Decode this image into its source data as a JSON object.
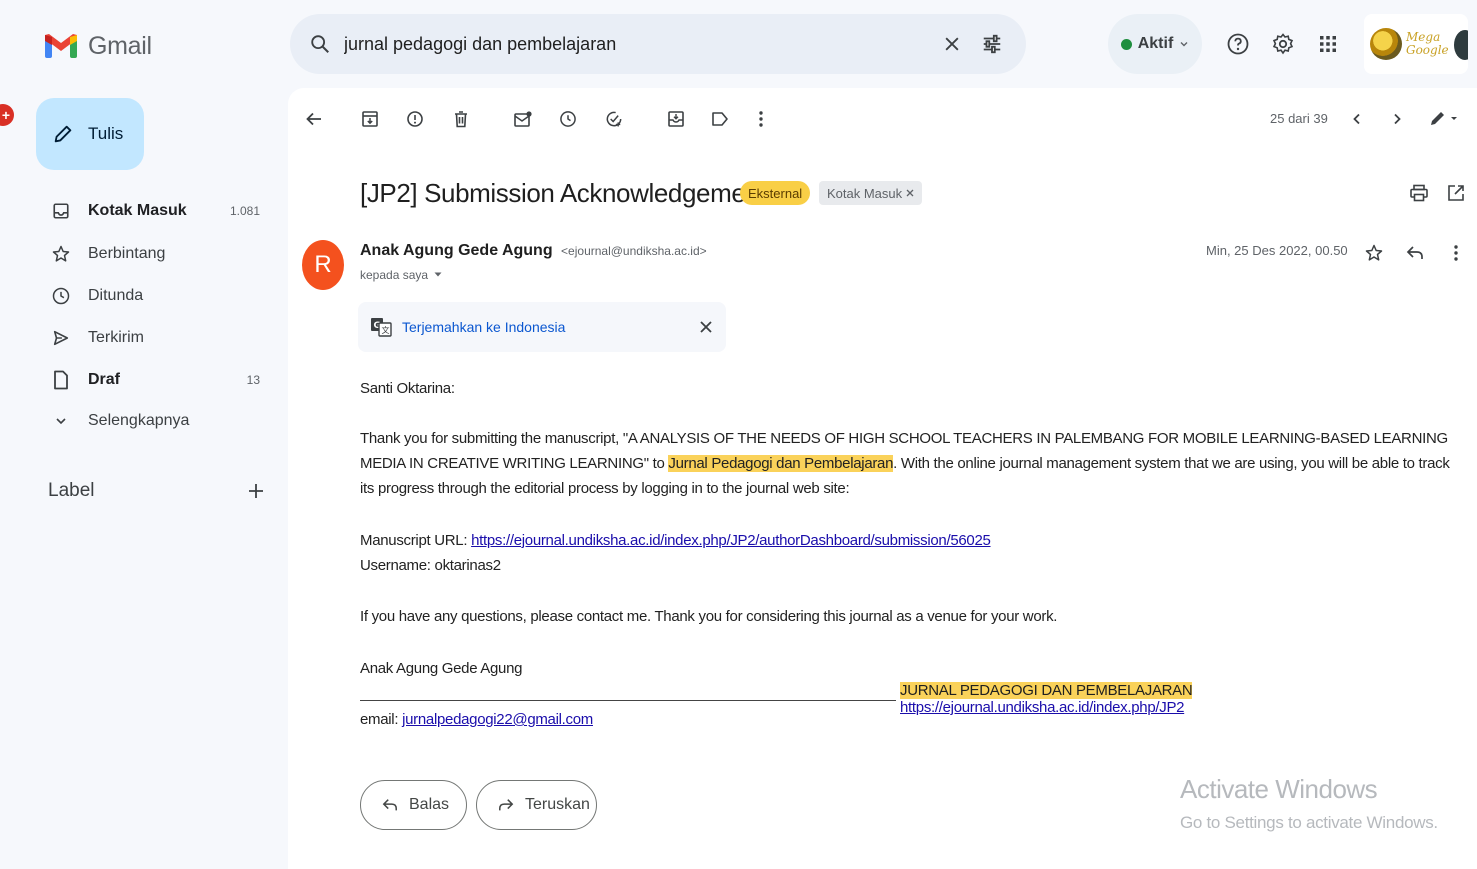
{
  "app": {
    "name": "Gmail"
  },
  "search": {
    "query": "jurnal pedagogi dan pembelajaran"
  },
  "status": {
    "label": "Aktif"
  },
  "account": {
    "logo_text": "Mega Google"
  },
  "compose": {
    "label": "Tulis"
  },
  "sidebar": {
    "items": [
      {
        "label": "Kotak Masuk",
        "count": "1.081",
        "icon": "inbox-icon"
      },
      {
        "label": "Berbintang",
        "count": "",
        "icon": "star-icon"
      },
      {
        "label": "Ditunda",
        "count": "",
        "icon": "clock-icon"
      },
      {
        "label": "Terkirim",
        "count": "",
        "icon": "send-icon"
      },
      {
        "label": "Draf",
        "count": "13",
        "icon": "file-icon"
      },
      {
        "label": "Selengkapnya",
        "count": "",
        "icon": "chevron-down-icon"
      }
    ],
    "labels_heading": "Label"
  },
  "toolbar": {
    "pager": "25 dari 39"
  },
  "email": {
    "subject": "[JP2] Submission Acknowledgement",
    "chip_external": "Eksternal",
    "chip_inbox": "Kotak Masuk",
    "sender_name": "Anak Agung Gede Agung",
    "sender_email": "<ejournal@undiksha.ac.id>",
    "avatar_letter": "R",
    "to": "kepada saya",
    "date": "Min, 25 Des 2022, 00.50",
    "translate": "Terjemahkan ke Indonesia",
    "greeting": "Santi Oktarina:",
    "p1_a": "Thank you for submitting the manuscript, \"A ANALYSIS OF THE NEEDS OF HIGH SCHOOL TEACHERS IN PALEMBANG FOR MOBILE LEARNING-BASED LEARNING MEDIA IN CREATIVE WRITING LEARNING\" to ",
    "p1_hl": "Jurnal Pedagogi dan Pembelajaran",
    "p1_b": ". With the online journal management system that we are using, you will be able to track its progress through the editorial process by logging in to the journal web site:",
    "url_label": "Manuscript URL: ",
    "url": "https://ejournal.undiksha.ac.id/index.php/JP2/authorDashboard/submission/56025",
    "username": "Username: oktarinas2",
    "p3": "If you have any questions, please contact me. Thank you for considering this journal as a venue for your work.",
    "sig_name": "Anak Agung Gede Agung",
    "sig_journal": "JURNAL PEDAGOGI DAN PEMBELAJARAN",
    "sig_url": "https://ejournal.undiksha.ac.id/index.php/JP2",
    "email_label": "email: ",
    "email_addr": "jurnalpedagogi22@gmail.com"
  },
  "actions": {
    "reply": "Balas",
    "forward": "Teruskan"
  },
  "watermark": {
    "line1": "Activate Windows",
    "line2": "Go to Settings to activate Windows."
  },
  "colors": {
    "accent": "#c2e7ff",
    "highlight": "#fad25a",
    "avatar": "#f4511e",
    "link": "#1a0dab"
  }
}
